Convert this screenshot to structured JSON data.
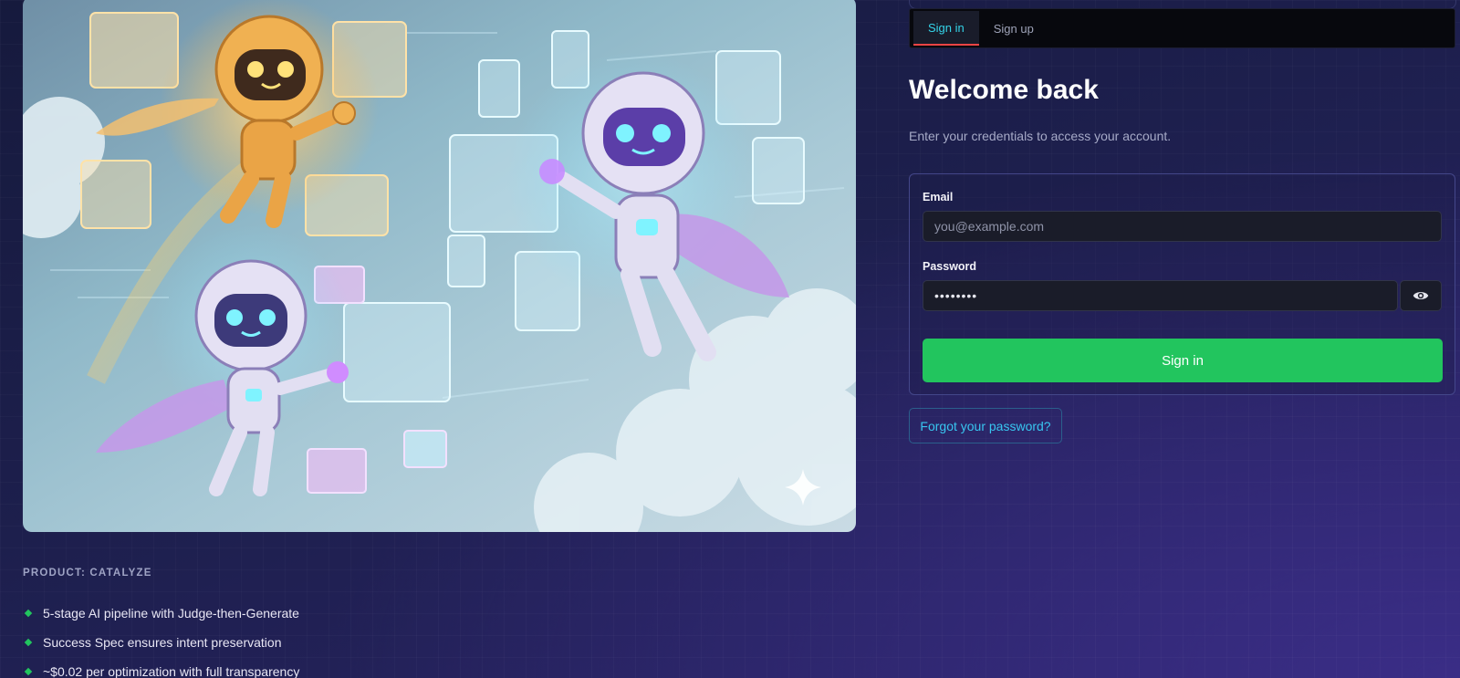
{
  "hero": {
    "image_alt": "Illustration of three flying robot superheroes with capes surrounded by floating code windows and documents"
  },
  "product": {
    "label": "PRODUCT: CATALYZE",
    "features": [
      "5-stage AI pipeline with Judge-then-Generate",
      "Success Spec ensures intent preservation",
      "~$0.02 per optimization with full transparency"
    ]
  },
  "auth": {
    "tabs": [
      {
        "label": "Sign in",
        "active": true
      },
      {
        "label": "Sign up",
        "active": false
      }
    ],
    "title": "Welcome back",
    "subtitle": "Enter your credentials to access your account.",
    "email": {
      "label": "Email",
      "placeholder": "you@example.com",
      "value": ""
    },
    "password": {
      "label": "Password",
      "value": "••••••••"
    },
    "submit_label": "Sign in",
    "forgot_label": "Forgot your password?"
  },
  "colors": {
    "accent_green": "#22c55e",
    "accent_cyan": "#34d3e8",
    "tab_underline": "#ef4444"
  },
  "icons": {
    "password_toggle": "eye-icon",
    "bullet": "diamond-bullet-icon",
    "sparkle": "sparkle-icon"
  }
}
